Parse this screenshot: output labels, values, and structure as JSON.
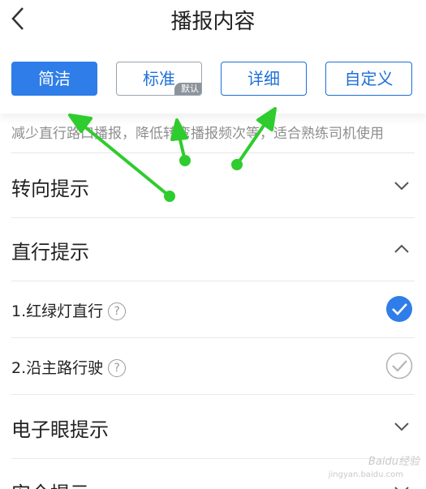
{
  "header": {
    "title": "播报内容"
  },
  "modes": [
    {
      "label": "简洁",
      "active": true
    },
    {
      "label": "标准",
      "badge": "默认"
    },
    {
      "label": "详细"
    },
    {
      "label": "自定义"
    }
  ],
  "description": "减少直行路口播报，降低转弯播报频次等，适合熟练司机使用",
  "sections": {
    "turn": {
      "label": "转向提示",
      "state": "collapsed"
    },
    "straight": {
      "label": "直行提示",
      "state": "expanded",
      "items": [
        {
          "label": "1.红绿灯直行",
          "help": "?",
          "checked": true
        },
        {
          "label": "2.沿主路行驶",
          "help": "?",
          "checked": false
        }
      ]
    },
    "camera": {
      "label": "电子眼提示",
      "state": "collapsed"
    },
    "safety": {
      "label": "安全提示",
      "state": "collapsed"
    }
  },
  "watermark": {
    "line1": "Baidu经验",
    "line2": "jingyan.baidu.com"
  },
  "colors": {
    "accent": "#2f7de8",
    "arrow": "#2ecc2e"
  }
}
